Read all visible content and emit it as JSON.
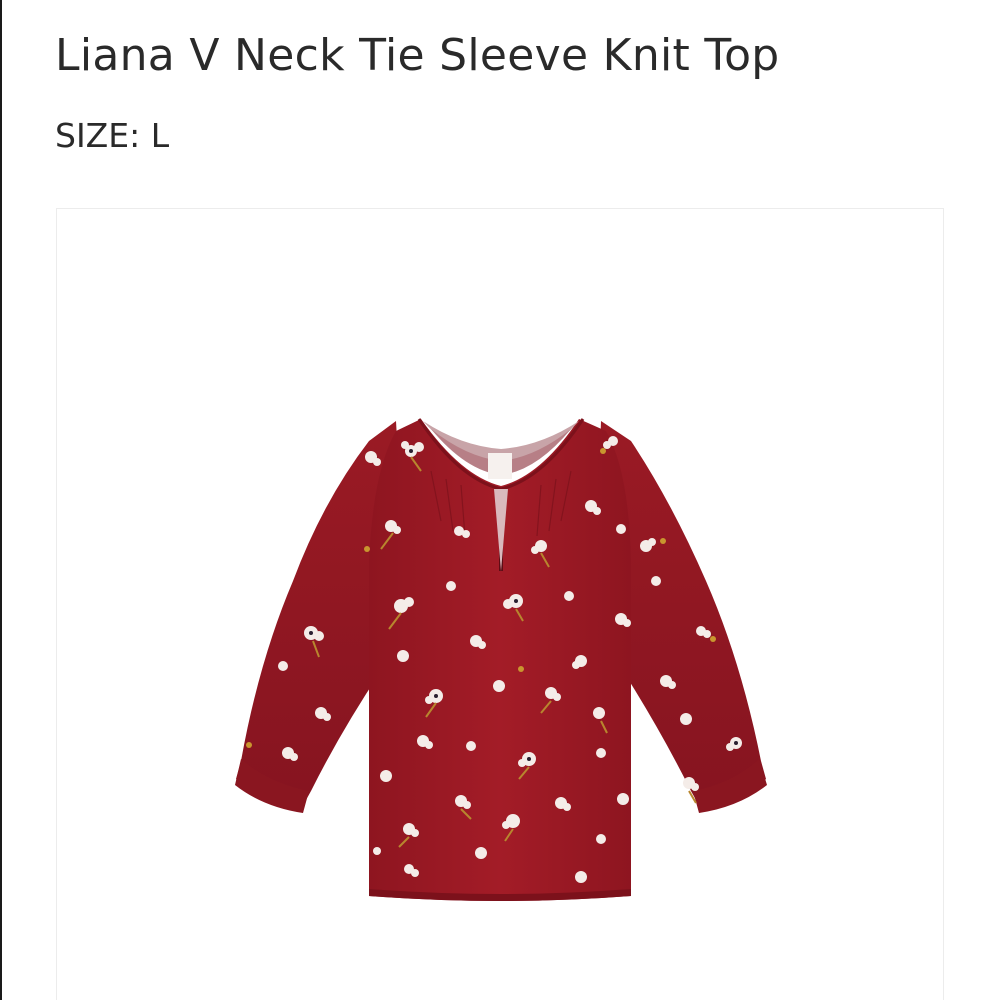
{
  "product": {
    "title": "Liana V Neck Tie Sleeve Knit Top",
    "size_label": "SIZE:",
    "size_value": "L"
  },
  "image": {
    "subject": "red-floral-blouse",
    "main_color": "#9e1a24",
    "print_color": "#f4ece8"
  }
}
